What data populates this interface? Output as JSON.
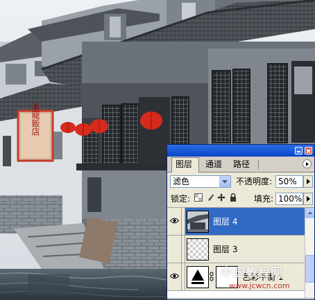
{
  "photo": {
    "shop_sign_text": "海 龍 飯 店"
  },
  "layers_panel": {
    "tabs": [
      {
        "label": "图层"
      },
      {
        "label": "通道"
      },
      {
        "label": "路径"
      }
    ],
    "blend_mode": "滤色",
    "opacity_label": "不透明度:",
    "opacity_value": "50%",
    "lock_label": "锁定:",
    "fill_label": "填充:",
    "fill_value": "100%",
    "layers": [
      {
        "name": "图层 4",
        "selected": true,
        "visible": true,
        "thumbnail": "photo"
      },
      {
        "name": "图层 3",
        "selected": false,
        "visible": false,
        "thumbnail": "transparent"
      },
      {
        "name": "色彩平衡 1",
        "selected": false,
        "visible": true,
        "thumbnail": "adjustment"
      }
    ]
  },
  "watermark": {
    "logo_text": "中国教程网",
    "url": "www.jcwcn.com"
  },
  "colors": {
    "titlebar": "#0a46c8",
    "selected_row": "#316ac5",
    "panel_bg": "#ece9d8",
    "lantern": "#d52a1c"
  }
}
